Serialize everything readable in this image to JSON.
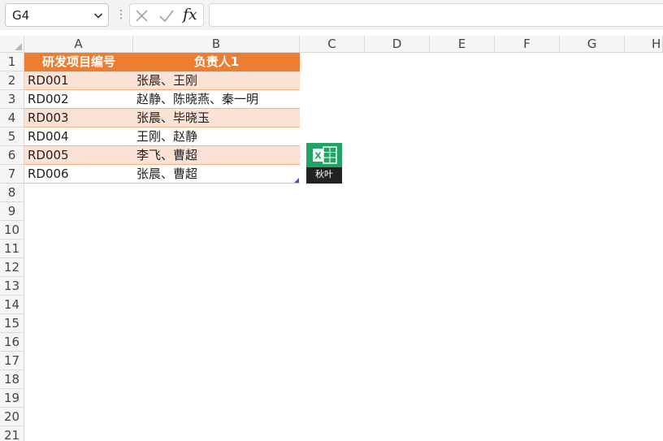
{
  "formula_bar": {
    "name_box": "G4",
    "fx": "fx",
    "formula": ""
  },
  "columns": [
    "A",
    "B",
    "C",
    "D",
    "E",
    "F",
    "G",
    "H"
  ],
  "rows": [
    "1",
    "2",
    "3",
    "4",
    "5",
    "6",
    "7",
    "8",
    "9",
    "10",
    "11",
    "12",
    "13",
    "14",
    "15",
    "16",
    "17",
    "18",
    "19",
    "20",
    "21"
  ],
  "table": {
    "headers": [
      "研发项目编号",
      "负责人1"
    ],
    "data": [
      [
        "RD001",
        "张晨、王刚"
      ],
      [
        "RD002",
        "赵静、陈晓燕、秦一明"
      ],
      [
        "RD003",
        "张晨、毕晓玉"
      ],
      [
        "RD004",
        "王刚、赵静"
      ],
      [
        "RD005",
        "李飞、曹超"
      ],
      [
        "RD006",
        "张晨、曹超"
      ]
    ]
  },
  "logo": {
    "text": "秋叶",
    "glyph": "X"
  },
  "colors": {
    "header_fill": "#ed7d31",
    "band_fill": "#fbe2d5",
    "logo_green": "#21a366"
  }
}
